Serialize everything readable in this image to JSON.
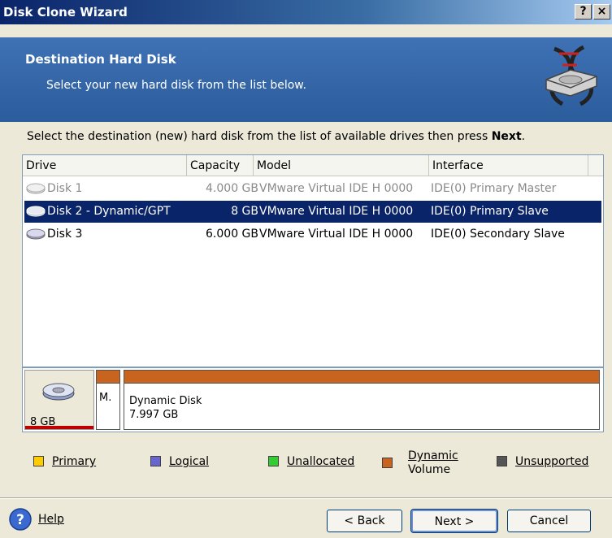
{
  "window": {
    "title": "Disk Clone Wizard",
    "help_button": "?",
    "close_button": "×"
  },
  "header": {
    "title": "Destination Hard Disk",
    "subtitle": "Select your new hard disk from the list below."
  },
  "instruction": {
    "text": "Select the destination (new) hard disk from the list of available drives then press ",
    "bold": "Next",
    "end": "."
  },
  "table": {
    "columns": [
      "Drive",
      "Capacity",
      "Model",
      "Interface"
    ],
    "rows": [
      {
        "drive": "Disk 1",
        "capacity": "4.000 GB",
        "model": "VMware Virtual IDE H 0000",
        "interface": "IDE(0) Primary Master",
        "state": "disabled"
      },
      {
        "drive": "Disk 2 - Dynamic/GPT",
        "capacity": "8 GB",
        "model": "VMware Virtual IDE H 0000",
        "interface": "IDE(0) Primary Slave",
        "state": "selected"
      },
      {
        "drive": "Disk 3",
        "capacity": "6.000 GB",
        "model": "VMware Virtual IDE H 0000",
        "interface": "IDE(0) Secondary Slave",
        "state": "normal"
      }
    ]
  },
  "disk_map": {
    "disk_size": "8 GB",
    "partition_small_label": "M.",
    "partition_name": "Dynamic Disk",
    "partition_size": "7.997 GB",
    "partition_color": "#c8641e"
  },
  "legend": {
    "primary": {
      "label": "Primary",
      "color": "#ffcc00"
    },
    "logical": {
      "label": "Logical",
      "color": "#6666cc"
    },
    "unallocated": {
      "label": "Unallocated",
      "color": "#33cc33"
    },
    "dynamic_line1": "Dynamic",
    "dynamic_line2": "Volume",
    "dynamic_color": "#c8641e",
    "unsupported": {
      "label": "Unsupported",
      "color": "#555555"
    }
  },
  "footer": {
    "help": "Help",
    "back": "< Back",
    "next": "Next >",
    "cancel": "Cancel"
  }
}
